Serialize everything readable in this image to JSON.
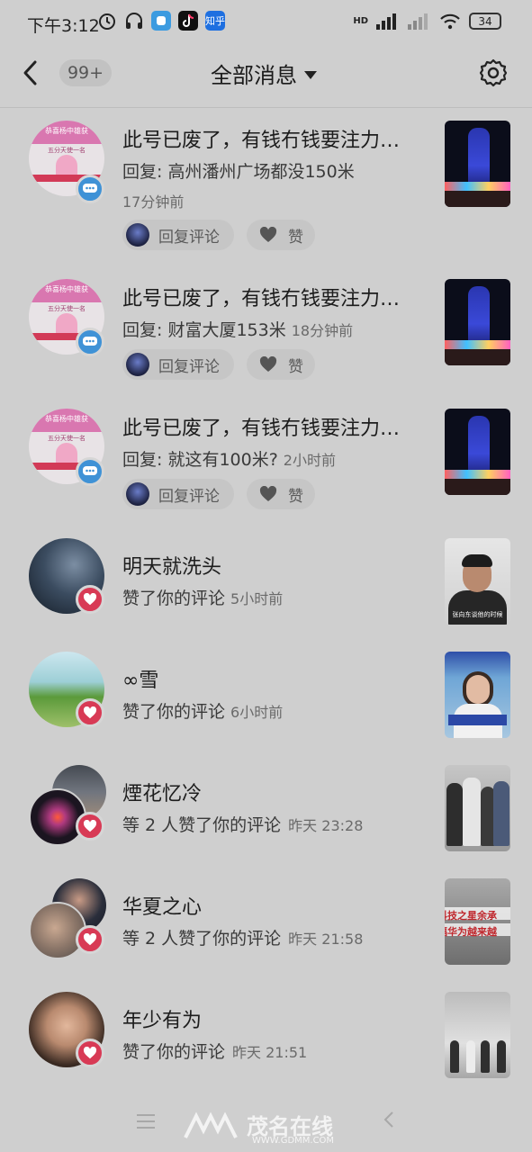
{
  "status_bar": {
    "time": "下午3:12",
    "network": "HD",
    "battery": "34",
    "app_icons": [
      "alarm-icon",
      "headphones-icon",
      "app-icon",
      "douyin-icon",
      "zhihu-icon"
    ],
    "zhihu_label": "知乎"
  },
  "header": {
    "back_icon": "back-arrow-icon",
    "unread_count": "99+",
    "title": "全部消息",
    "settings_icon": "gear-icon"
  },
  "items": [
    {
      "name": "此号已废了，有钱冇钱要注力…",
      "desc": "回复: 高州潘州广场都没150米",
      "time": "17分钟前",
      "badge": "comment",
      "reply_label": "回复评论",
      "like_label": "赞",
      "avatar_title": "恭喜杨中雄获",
      "avatar_sub": "五分天使一名"
    },
    {
      "name": "此号已废了，有钱冇钱要注力…",
      "desc": "回复: 财富大厦153米",
      "time": "18分钟前",
      "badge": "comment",
      "reply_label": "回复评论",
      "like_label": "赞",
      "avatar_title": "恭喜杨中雄获",
      "avatar_sub": "五分天使一名"
    },
    {
      "name": "此号已废了，有钱冇钱要注力…",
      "desc": "回复: 就这有100米?",
      "time": "2小时前",
      "badge": "comment",
      "reply_label": "回复评论",
      "like_label": "赞",
      "avatar_title": "恭喜杨中雄获",
      "avatar_sub": "五分天使一名"
    },
    {
      "name": "明天就洗头",
      "desc": "赞了你的评论",
      "time": "5小时前",
      "badge": "like",
      "thumb_caption": "张向东谈他的时候"
    },
    {
      "name": "∞雪",
      "desc": "赞了你的评论",
      "time": "6小时前",
      "badge": "like"
    },
    {
      "name": "煙花忆冷",
      "desc": "等 2 人赞了你的评论",
      "time": "昨天 23:28",
      "badge": "like"
    },
    {
      "name": "华夏之心",
      "desc": "等 2 人赞了你的评论",
      "time": "昨天 21:58",
      "badge": "like",
      "thumb_line1": "科技之星余承",
      "thumb_line2": "福华为越来越"
    },
    {
      "name": "年少有为",
      "desc": "赞了你的评论",
      "time": "昨天 21:51",
      "badge": "like"
    }
  ],
  "watermark": {
    "brand": "茂名在线",
    "url": "WWW.GDMM.COM"
  },
  "colors": {
    "background": "#cfcfcf",
    "comment_badge": "#3f92d6",
    "like_badge": "#d83a55"
  }
}
